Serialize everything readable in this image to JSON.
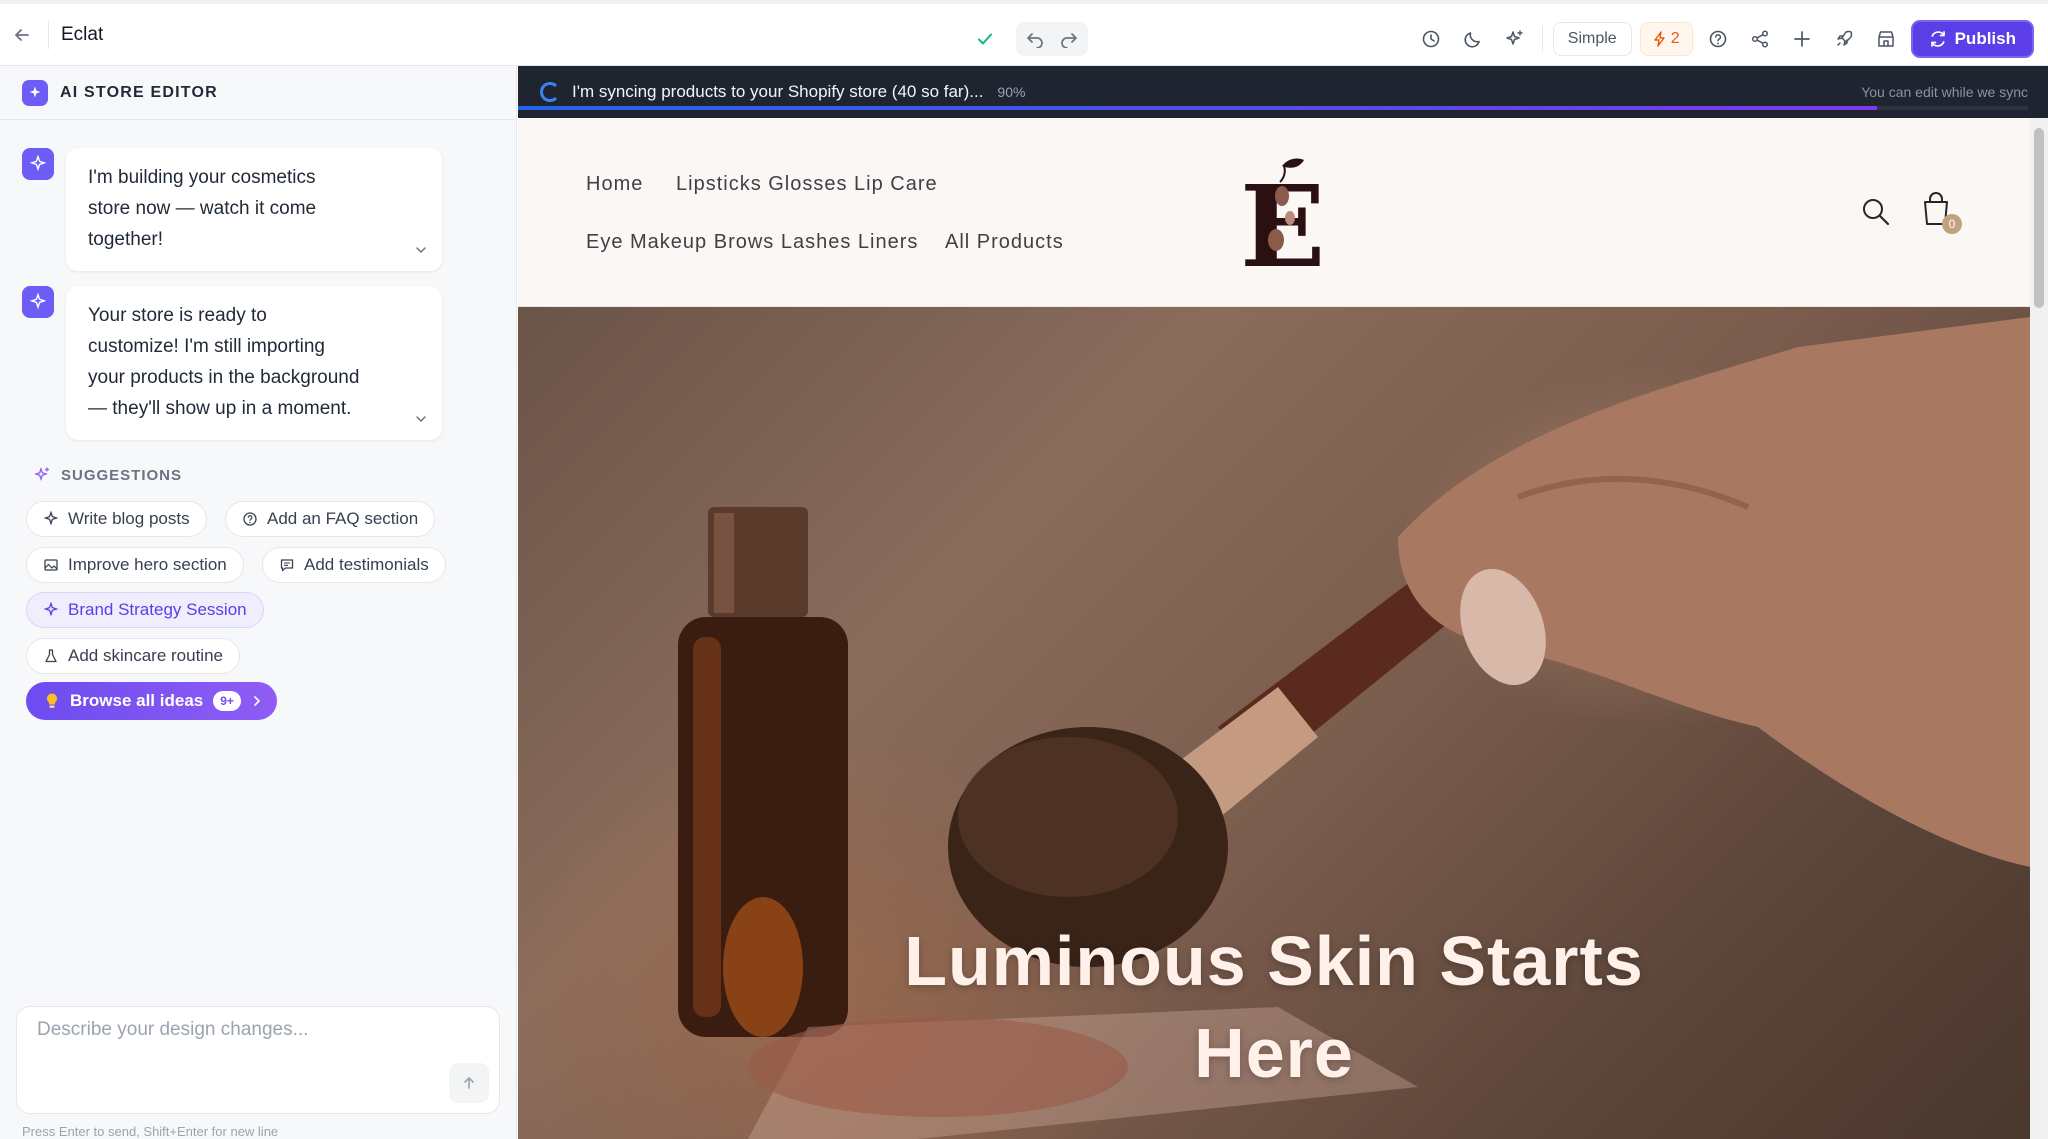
{
  "topbar": {
    "app_name": "Eclat",
    "mode_label": "Simple",
    "credits": "2",
    "publish_label": "Publish"
  },
  "sidebar": {
    "title": "AI STORE EDITOR",
    "messages": [
      {
        "text_lines": [
          "I'm building your cosmetics",
          "store now — watch it come",
          "together!"
        ]
      },
      {
        "text_lines": [
          "Your store is ready to",
          "customize! I'm still importing",
          "your products in the background",
          "— they'll show up in a moment."
        ]
      }
    ],
    "suggestions_label": "SUGGESTIONS",
    "suggestions": [
      {
        "label": "Write blog posts",
        "icon": "sparkle-icon"
      },
      {
        "label": "Add an FAQ section",
        "icon": "help-circle-icon"
      },
      {
        "label": "Improve hero section",
        "icon": "image-icon"
      },
      {
        "label": "Add testimonials",
        "icon": "chat-icon"
      },
      {
        "label": "Brand Strategy Session",
        "icon": "sparkle-icon"
      },
      {
        "label": "Add skincare routine",
        "icon": "flask-icon"
      }
    ],
    "browse_label": "Browse all ideas",
    "browse_badge": "9+",
    "composer_placeholder": "Describe your design changes...",
    "composer_hint": "Press Enter to send, Shift+Enter for new line"
  },
  "sync": {
    "text": "I'm syncing products to your Shopify store (40 so far)...",
    "percent_label": "90%",
    "progress": 0.9,
    "note": "You can edit while we sync"
  },
  "store": {
    "nav": [
      "Home",
      "Lipsticks Glosses Lip Care",
      "Eye Makeup Brows Lashes Liners",
      "All Products"
    ],
    "cart_count": "0",
    "hero_title_lines": [
      "Luminous Skin Starts",
      "Here"
    ]
  },
  "colors": {
    "accent": "#5b3ee6",
    "sync_bar": "#1e2531",
    "store_bg": "#fbf7f4"
  }
}
